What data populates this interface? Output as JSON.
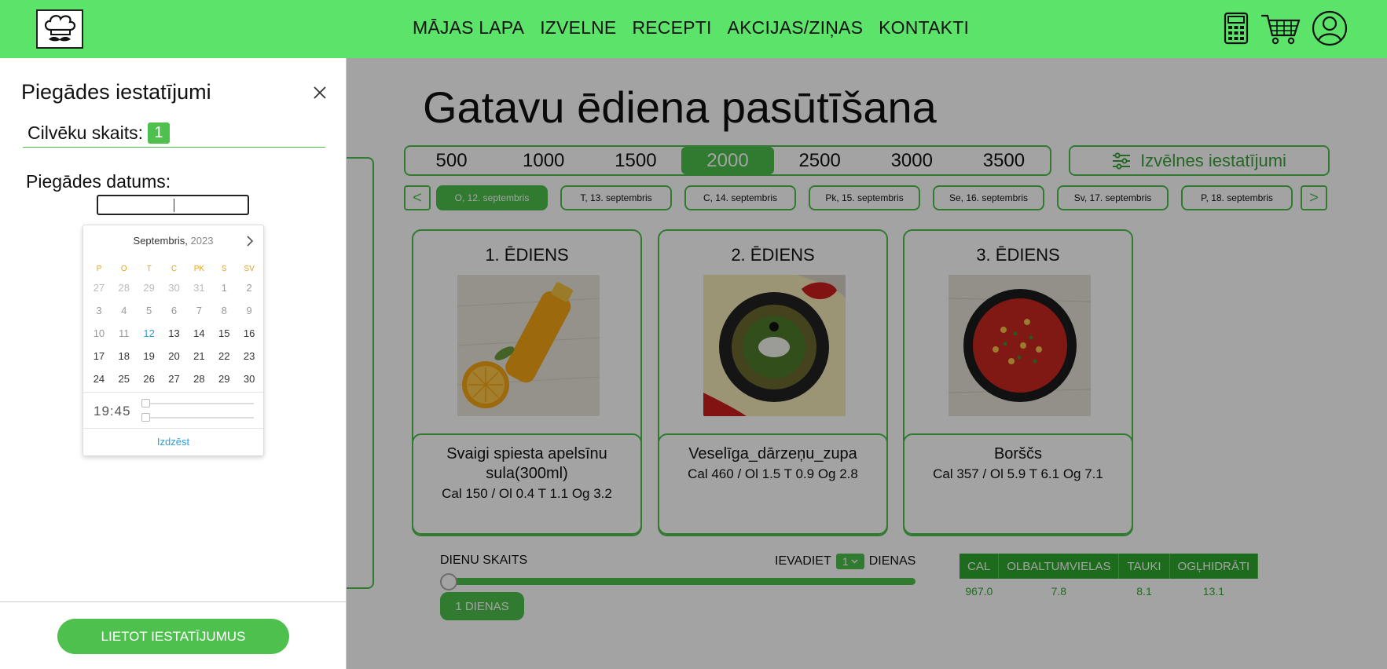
{
  "header": {
    "nav": [
      "MĀJAS LAPA",
      "IZVELNE",
      "RECEPTI",
      "AKCIJAS/ZIŅAS",
      "KONTAKTI"
    ]
  },
  "main": {
    "title": "Gatavu ēdiena pasūtīšana",
    "calorie_options": [
      "500",
      "1000",
      "1500",
      "2000",
      "2500",
      "3000",
      "3500"
    ],
    "selected_calorie": "2000",
    "settings_label": "Izvēlnes iestatījumi",
    "days": [
      "O, 12. septembris",
      "T, 13. septembris",
      "C, 14. septembris",
      "Pk, 15. septembris",
      "Se, 16. septembris",
      "Sv, 17. septembris",
      "P, 18. septembris"
    ],
    "selected_day": "O, 12. septembris",
    "arrow_prev": "<",
    "arrow_next": ">",
    "meals": [
      {
        "title": "1. ĒDIENS",
        "name": "Svaigi spiesta apelsīnu sula(300ml)",
        "nutrition": "Cal 150 / Ol 0.4  T 1.1  Og 3.2"
      },
      {
        "title": "2. ĒDIENS",
        "name": "Veselīga_dārzeņu_zupa",
        "nutrition": "Cal 460 / Ol 1.5  T 0.9  Og 2.8"
      },
      {
        "title": "3. ĒDIENS",
        "name": "Borščs",
        "nutrition": "Cal 357 / Ol 5.9  T 6.1  Og 7.1"
      }
    ],
    "days_count_label": "DIENU SKAITS",
    "enter_label": "IEVADIET",
    "enter_value": "1",
    "days_word": "DIENAS",
    "days_badge": "1 DIENAS",
    "nutrition_table": {
      "headers": [
        "CAL",
        "OLBALTUMVIELAS",
        "TAUKI",
        "OGĻHIDRĀTI"
      ],
      "values": [
        "967.0",
        "7.8",
        "8.1",
        "13.1"
      ]
    }
  },
  "side": {
    "title": "Piegādes iestatījumi",
    "people_label": "Cilvēku skaits:",
    "people_value": "1",
    "date_label": "Piegādes datums:",
    "picker": {
      "month": "Septembris,",
      "year": "2023",
      "weekdays": [
        "P",
        "O",
        "T",
        "C",
        "PK",
        "S",
        "SV"
      ],
      "weeks": [
        [
          "27",
          "28",
          "29",
          "30",
          "31",
          "1",
          "2"
        ],
        [
          "3",
          "4",
          "5",
          "6",
          "7",
          "8",
          "9"
        ],
        [
          "10",
          "11",
          "12",
          "13",
          "14",
          "15",
          "16"
        ],
        [
          "17",
          "18",
          "19",
          "20",
          "21",
          "22",
          "23"
        ],
        [
          "24",
          "25",
          "26",
          "27",
          "28",
          "29",
          "30"
        ]
      ],
      "time": "19:45",
      "clear": "Izdzēst"
    },
    "apply_label": "LIETOT IESTATĪJUMUS"
  }
}
